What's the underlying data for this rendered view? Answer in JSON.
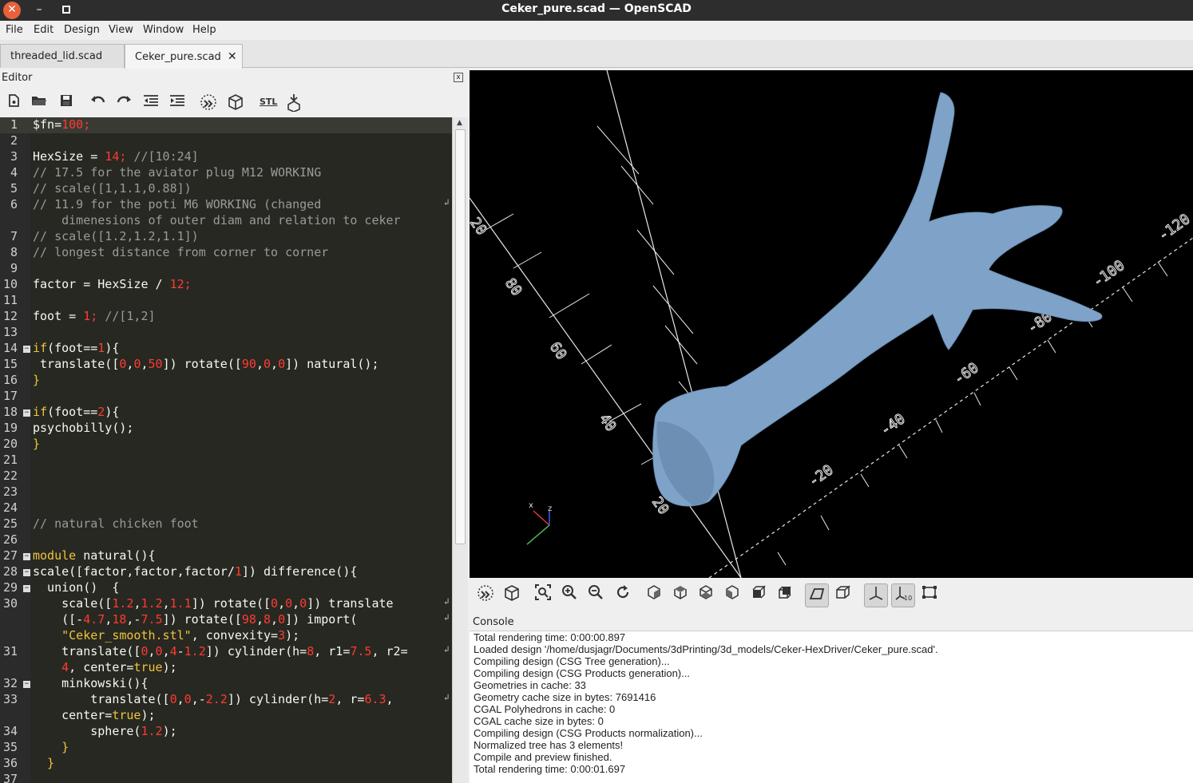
{
  "window": {
    "title": "Ceker_pure.scad — OpenSCAD",
    "close_glyph": "✕",
    "min_glyph": "–"
  },
  "menu": [
    "File",
    "Edit",
    "Design",
    "View",
    "Window",
    "Help"
  ],
  "tabs": [
    {
      "label": "threaded_lid.scad",
      "active": false
    },
    {
      "label": "Ceker_pure.scad",
      "active": true
    }
  ],
  "tab_close_glyph": "✕",
  "editor": {
    "title": "Editor",
    "close_glyph": "x",
    "toolbar_icons": [
      "new-file-icon",
      "open-file-icon",
      "save-icon",
      "undo-icon",
      "redo-icon",
      "unindent-icon",
      "indent-icon",
      "preview-icon",
      "render-icon",
      "export-stl-icon",
      "send-to-print-icon"
    ],
    "stl_label": "STL",
    "lines": [
      {
        "n": "1",
        "tokens": [
          [
            "id",
            "$fn="
          ],
          [
            "num",
            "100"
          ],
          [
            "num",
            ";"
          ]
        ],
        "current": true
      },
      {
        "n": "2",
        "tokens": []
      },
      {
        "n": "3",
        "tokens": [
          [
            "id",
            "HexSize = "
          ],
          [
            "num",
            "14"
          ],
          [
            "num",
            "; "
          ],
          [
            "com",
            "//[10:24]"
          ]
        ]
      },
      {
        "n": "4",
        "tokens": [
          [
            "com",
            "// 17.5 for the aviator plug M12 WORKING"
          ]
        ]
      },
      {
        "n": "5",
        "tokens": [
          [
            "com",
            "// scale([1,1.1,0.88])"
          ]
        ]
      },
      {
        "n": "6",
        "tokens": [
          [
            "com",
            "// 11.9 for the poti M6 WORKING (changed"
          ]
        ],
        "wrap": true
      },
      {
        "n": "",
        "tokens": [
          [
            "com",
            "    dimenesions of outer diam and relation to ceker"
          ]
        ]
      },
      {
        "n": "7",
        "tokens": [
          [
            "com",
            "// scale([1.2,1.2,1.1])"
          ]
        ]
      },
      {
        "n": "8",
        "tokens": [
          [
            "com",
            "// longest distance from corner to corner"
          ]
        ]
      },
      {
        "n": "9",
        "tokens": []
      },
      {
        "n": "10",
        "tokens": [
          [
            "id",
            "factor = HexSize / "
          ],
          [
            "num",
            "12"
          ],
          [
            "num",
            ";"
          ]
        ]
      },
      {
        "n": "11",
        "tokens": []
      },
      {
        "n": "12",
        "tokens": [
          [
            "id",
            "foot = "
          ],
          [
            "num",
            "1"
          ],
          [
            "num",
            "; "
          ],
          [
            "com",
            "//[1,2]"
          ]
        ]
      },
      {
        "n": "13",
        "tokens": []
      },
      {
        "n": "14",
        "tokens": [
          [
            "key",
            "if"
          ],
          [
            "id",
            "(foot=="
          ],
          [
            "num",
            "1"
          ],
          [
            "id",
            "){"
          ]
        ],
        "fold": true
      },
      {
        "n": "15",
        "tokens": [
          [
            "id",
            " translate(["
          ],
          [
            "num",
            "0"
          ],
          [
            "id",
            ","
          ],
          [
            "num",
            "0"
          ],
          [
            "id",
            ","
          ],
          [
            "num",
            "50"
          ],
          [
            "id",
            "]) rotate(["
          ],
          [
            "num",
            "90"
          ],
          [
            "id",
            ","
          ],
          [
            "num",
            "0"
          ],
          [
            "id",
            ","
          ],
          [
            "num",
            "0"
          ],
          [
            "id",
            "]) natural();"
          ]
        ]
      },
      {
        "n": "16",
        "tokens": [
          [
            "key",
            "}"
          ]
        ]
      },
      {
        "n": "17",
        "tokens": []
      },
      {
        "n": "18",
        "tokens": [
          [
            "key",
            "if"
          ],
          [
            "id",
            "(foot=="
          ],
          [
            "num",
            "2"
          ],
          [
            "id",
            "){"
          ]
        ],
        "fold": true
      },
      {
        "n": "19",
        "tokens": [
          [
            "id",
            "psychobilly();"
          ]
        ]
      },
      {
        "n": "20",
        "tokens": [
          [
            "key",
            "}"
          ]
        ]
      },
      {
        "n": "21",
        "tokens": []
      },
      {
        "n": "22",
        "tokens": []
      },
      {
        "n": "23",
        "tokens": []
      },
      {
        "n": "24",
        "tokens": []
      },
      {
        "n": "25",
        "tokens": [
          [
            "com",
            "// natural chicken foot"
          ]
        ]
      },
      {
        "n": "26",
        "tokens": []
      },
      {
        "n": "27",
        "tokens": [
          [
            "key",
            "module"
          ],
          [
            "id",
            " natural(){"
          ]
        ],
        "fold": true
      },
      {
        "n": "28",
        "tokens": [
          [
            "id",
            "scale([factor,factor,factor/"
          ],
          [
            "num",
            "1"
          ],
          [
            "id",
            "]) difference(){"
          ]
        ],
        "fold": true
      },
      {
        "n": "29",
        "tokens": [
          [
            "id",
            "  union()  {"
          ]
        ],
        "fold": true
      },
      {
        "n": "30",
        "tokens": [
          [
            "id",
            "    scale(["
          ],
          [
            "num",
            "1.2"
          ],
          [
            "id",
            ","
          ],
          [
            "num",
            "1.2"
          ],
          [
            "id",
            ","
          ],
          [
            "num",
            "1.1"
          ],
          [
            "id",
            "]) rotate(["
          ],
          [
            "num",
            "0"
          ],
          [
            "id",
            ","
          ],
          [
            "num",
            "0"
          ],
          [
            "id",
            ","
          ],
          [
            "num",
            "0"
          ],
          [
            "id",
            "]) translate"
          ]
        ],
        "wrap": true
      },
      {
        "n": "",
        "tokens": [
          [
            "id",
            "    ([-"
          ],
          [
            "num",
            "4.7"
          ],
          [
            "id",
            ","
          ],
          [
            "num",
            "18"
          ],
          [
            "id",
            ",-"
          ],
          [
            "num",
            "7.5"
          ],
          [
            "id",
            "]) rotate(["
          ],
          [
            "num",
            "98"
          ],
          [
            "id",
            ","
          ],
          [
            "num",
            "8"
          ],
          [
            "id",
            ","
          ],
          [
            "num",
            "0"
          ],
          [
            "id",
            "]) import("
          ]
        ],
        "wrap": true
      },
      {
        "n": "",
        "tokens": [
          [
            "str",
            "    \"Ceker_smooth.stl\""
          ],
          [
            "id",
            ", convexity="
          ],
          [
            "num",
            "3"
          ],
          [
            "id",
            ");"
          ]
        ]
      },
      {
        "n": "31",
        "tokens": [
          [
            "id",
            "    translate(["
          ],
          [
            "num",
            "0"
          ],
          [
            "id",
            ","
          ],
          [
            "num",
            "0"
          ],
          [
            "id",
            ","
          ],
          [
            "num",
            "4"
          ],
          [
            "id",
            "-"
          ],
          [
            "num",
            "1.2"
          ],
          [
            "id",
            "]) cylinder(h="
          ],
          [
            "num",
            "8"
          ],
          [
            "id",
            ", r1="
          ],
          [
            "num",
            "7.5"
          ],
          [
            "id",
            ", r2="
          ]
        ],
        "wrap": true
      },
      {
        "n": "",
        "tokens": [
          [
            "num",
            "    4"
          ],
          [
            "id",
            ", center="
          ],
          [
            "key",
            "true"
          ],
          [
            "id",
            ");"
          ]
        ]
      },
      {
        "n": "32",
        "tokens": [
          [
            "id",
            "    minkowski(){"
          ]
        ],
        "fold": true
      },
      {
        "n": "33",
        "tokens": [
          [
            "id",
            "        translate(["
          ],
          [
            "num",
            "0"
          ],
          [
            "id",
            ","
          ],
          [
            "num",
            "0"
          ],
          [
            "id",
            ",-"
          ],
          [
            "num",
            "2.2"
          ],
          [
            "id",
            "]) cylinder(h="
          ],
          [
            "num",
            "2"
          ],
          [
            "id",
            ", r="
          ],
          [
            "num",
            "6.3"
          ],
          [
            "id",
            ","
          ]
        ],
        "wrap": true
      },
      {
        "n": "",
        "tokens": [
          [
            "id",
            "    center="
          ],
          [
            "key",
            "true"
          ],
          [
            "id",
            ");"
          ]
        ]
      },
      {
        "n": "34",
        "tokens": [
          [
            "id",
            "        sphere("
          ],
          [
            "num",
            "1.2"
          ],
          [
            "id",
            ");"
          ]
        ]
      },
      {
        "n": "35",
        "tokens": [
          [
            "key",
            "    }"
          ]
        ]
      },
      {
        "n": "36",
        "tokens": [
          [
            "key",
            "  }"
          ]
        ]
      },
      {
        "n": "37",
        "tokens": []
      }
    ]
  },
  "viewport": {
    "model_color": "#7fa3c8",
    "axis_labels": [
      "-20",
      "-40",
      "-60",
      "-80",
      "-100",
      "-120",
      "20",
      "40",
      "60",
      "80",
      "20"
    ],
    "axes_indicator": {
      "x": "x",
      "z": "z"
    }
  },
  "view_toolbar_icons": [
    "preview-icon",
    "render-icon",
    "view-all-icon",
    "zoom-in-icon",
    "zoom-out-icon",
    "reset-view-icon",
    "view-right-icon",
    "view-top-icon",
    "view-bottom-icon",
    "view-left-icon",
    "view-front-icon",
    "view-back-icon",
    "perspective-icon",
    "orthogonal-icon",
    "show-axes-icon",
    "show-scale-markers-icon",
    "show-edges-icon"
  ],
  "console": {
    "title": "Console",
    "lines": [
      "Total rendering time: 0:00:00.897",
      "Loaded design '/home/dusjagr/Documents/3dPrinting/3d_models/Ceker-HexDriver/Ceker_pure.scad'.",
      "Compiling design (CSG Tree generation)...",
      "Compiling design (CSG Products generation)...",
      "Geometries in cache: 33",
      "Geometry cache size in bytes: 7691416",
      "CGAL Polyhedrons in cache: 0",
      "CGAL cache size in bytes: 0",
      "Compiling design (CSG Products normalization)...",
      "Normalized tree has 3 elements!",
      "Compile and preview finished.",
      "Total rendering time: 0:00:01.697"
    ]
  }
}
